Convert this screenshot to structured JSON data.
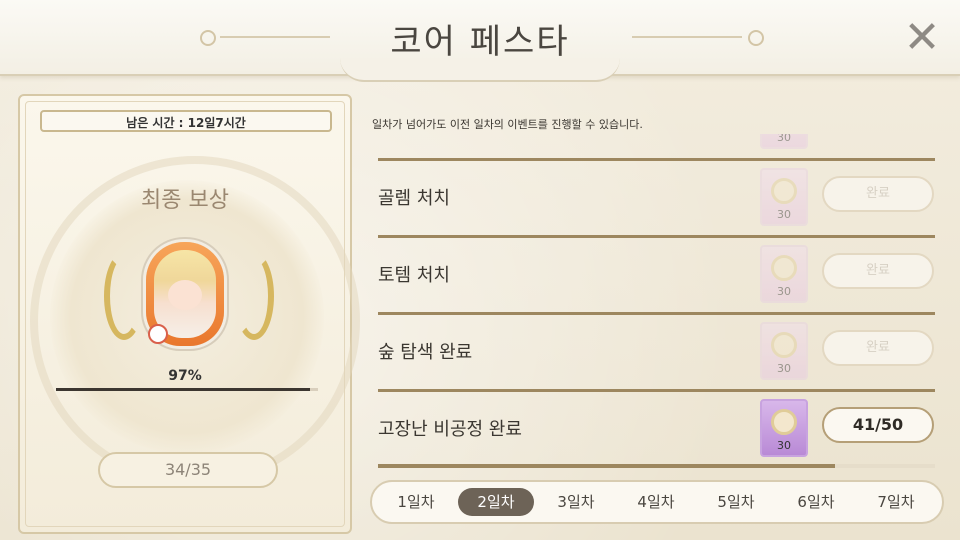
{
  "header": {
    "title": "코어 페스타"
  },
  "left_panel": {
    "remaining_time": "남은 시간 : 12일7시간",
    "reward_title": "최종 보상",
    "progress_percent": 97,
    "progress_text": "97%",
    "count_text": "34/35"
  },
  "notice": "일차가 넘어가도 이전 일차의 이벤트를 진행할 수 있습니다.",
  "missions": [
    {
      "label": "",
      "reward_qty": "30",
      "status": "",
      "state": "done"
    },
    {
      "label": "골렘 처치",
      "reward_qty": "30",
      "status": "완료",
      "state": "done"
    },
    {
      "label": "토템 처치",
      "reward_qty": "30",
      "status": "완료",
      "state": "done"
    },
    {
      "label": "숲 탐색 완료",
      "reward_qty": "30",
      "status": "완료",
      "state": "done"
    },
    {
      "label": "고장난 비공정 완료",
      "reward_qty": "30",
      "status": "41/50",
      "state": "active",
      "progress": 0.82
    }
  ],
  "days": [
    {
      "label": "1일차",
      "active": false
    },
    {
      "label": "2일차",
      "active": true
    },
    {
      "label": "3일차",
      "active": false
    },
    {
      "label": "4일차",
      "active": false
    },
    {
      "label": "5일차",
      "active": false
    },
    {
      "label": "6일차",
      "active": false
    },
    {
      "label": "7일차",
      "active": false
    }
  ],
  "icons": {
    "close": "close-icon",
    "reward_coin": "coin-icon",
    "laurel": "laurel-icon"
  }
}
